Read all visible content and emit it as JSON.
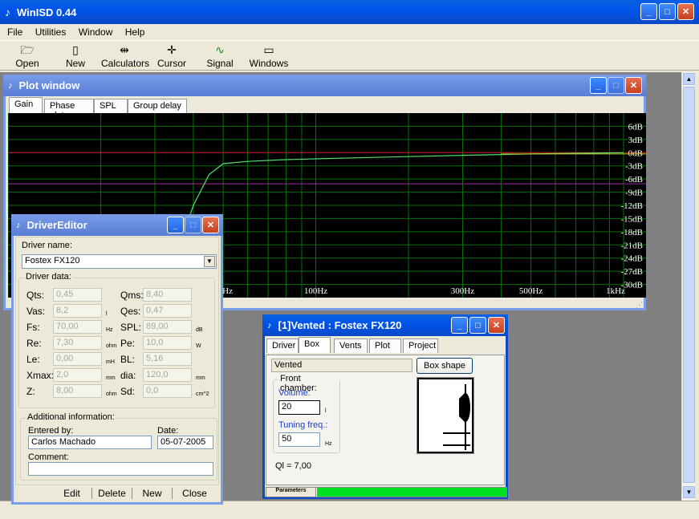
{
  "app": {
    "title": "WinISD 0.44"
  },
  "menu": [
    "File",
    "Utilities",
    "Window",
    "Help"
  ],
  "toolbar": [
    {
      "label": "Open",
      "icon": "folder-open-icon"
    },
    {
      "label": "New",
      "icon": "new-document-icon"
    },
    {
      "label": "Calculators",
      "icon": "calculator-icon"
    },
    {
      "label": "Cursor",
      "icon": "crosshair-icon"
    },
    {
      "label": "Signal gen.",
      "icon": "sine-wave-icon"
    },
    {
      "label": "Windows",
      "icon": "window-icon"
    }
  ],
  "plot": {
    "title": "Plot window",
    "tabs": [
      "Gain",
      "Phase plot",
      "SPL",
      "Group delay"
    ],
    "y_labels": [
      "6dB",
      "3dB",
      "0dB",
      "-3dB",
      "-6dB",
      "-9dB",
      "-12dB",
      "-15dB",
      "-18dB",
      "-21dB",
      "-24dB",
      "-27dB",
      "-30dB"
    ],
    "x_labels": [
      "50Hz",
      "100Hz",
      "300Hz",
      "500Hz",
      "1kHz"
    ],
    "colors": {
      "bg": "#000000",
      "grid": "#0A6E0A",
      "zero_line": "#C82828",
      "curve": "#50E070",
      "magenta": "#9A2A9A"
    }
  },
  "chart_data": {
    "type": "line",
    "ylabel": "",
    "xlabel": "",
    "y_ticks": [
      6,
      3,
      0,
      -3,
      -6,
      -9,
      -12,
      -15,
      -18,
      -21,
      -24,
      -27,
      -30
    ],
    "x_ticks": [
      "50Hz",
      "100Hz",
      "300Hz",
      "500Hz",
      "1kHz"
    ],
    "series": [
      {
        "x": [
          30,
          35,
          40,
          45,
          50,
          60,
          80,
          100,
          150,
          200,
          300,
          500,
          1000
        ],
        "values": [
          -36,
          -24,
          -12,
          -5,
          -2.5,
          -2,
          -1.6,
          -1.4,
          -1.1,
          -0.9,
          -0.6,
          -0.3,
          0
        ]
      }
    ]
  },
  "driver_editor": {
    "title": "DriverEditor",
    "name_label": "Driver name:",
    "driver_name": "Fostex FX120",
    "data_label": "Driver data:",
    "fields_left": [
      {
        "label": "Qts:",
        "value": "0,45",
        "unit": ""
      },
      {
        "label": "Vas:",
        "value": "8,2",
        "unit": "l"
      },
      {
        "label": "Fs:",
        "value": "70,00",
        "unit": "Hz"
      },
      {
        "label": "Re:",
        "value": "7,30",
        "unit": "ohm"
      },
      {
        "label": "Le:",
        "value": "0,00",
        "unit": "mH"
      },
      {
        "label": "Xmax:",
        "value": "2,0",
        "unit": "mm"
      },
      {
        "label": "Z:",
        "value": "8,00",
        "unit": "ohm"
      }
    ],
    "fields_right": [
      {
        "label": "Qms:",
        "value": "8,40",
        "unit": ""
      },
      {
        "label": "Qes:",
        "value": "0,47",
        "unit": ""
      },
      {
        "label": "SPL:",
        "value": "89,00",
        "unit": "dB"
      },
      {
        "label": "Pe:",
        "value": "10,0",
        "unit": "W"
      },
      {
        "label": "BL:",
        "value": "5,16",
        "unit": ""
      },
      {
        "label": "dia:",
        "value": "120,0",
        "unit": "mm"
      },
      {
        "label": "Sd:",
        "value": "0,0",
        "unit": "cm^2"
      }
    ],
    "additional_label": "Additional information:",
    "entered_label": "Entered by:",
    "entered_value": "Carlos Machado",
    "date_label": "Date:",
    "date_value": "05-07-2005",
    "comment_label": "Comment:",
    "comment_value": "",
    "buttons": [
      "Edit",
      "Delete",
      "New",
      "Close"
    ]
  },
  "vented": {
    "title": "[1]Vented : Fostex FX120",
    "tabs": [
      "Driver",
      "Box",
      "Vents",
      "Plot",
      "Project"
    ],
    "box_type": "Vented",
    "box_shape_label": "Box shape",
    "front_label": "Front chamber:",
    "volume_label": "Volume:",
    "volume_value": "20",
    "volume_unit": "l",
    "tuning_label": "Tuning freq.:",
    "tuning_value": "50",
    "tuning_unit": "Hz",
    "ql": "Ql = 7,00",
    "status_label": "Parameters",
    "progress": 1.0
  }
}
